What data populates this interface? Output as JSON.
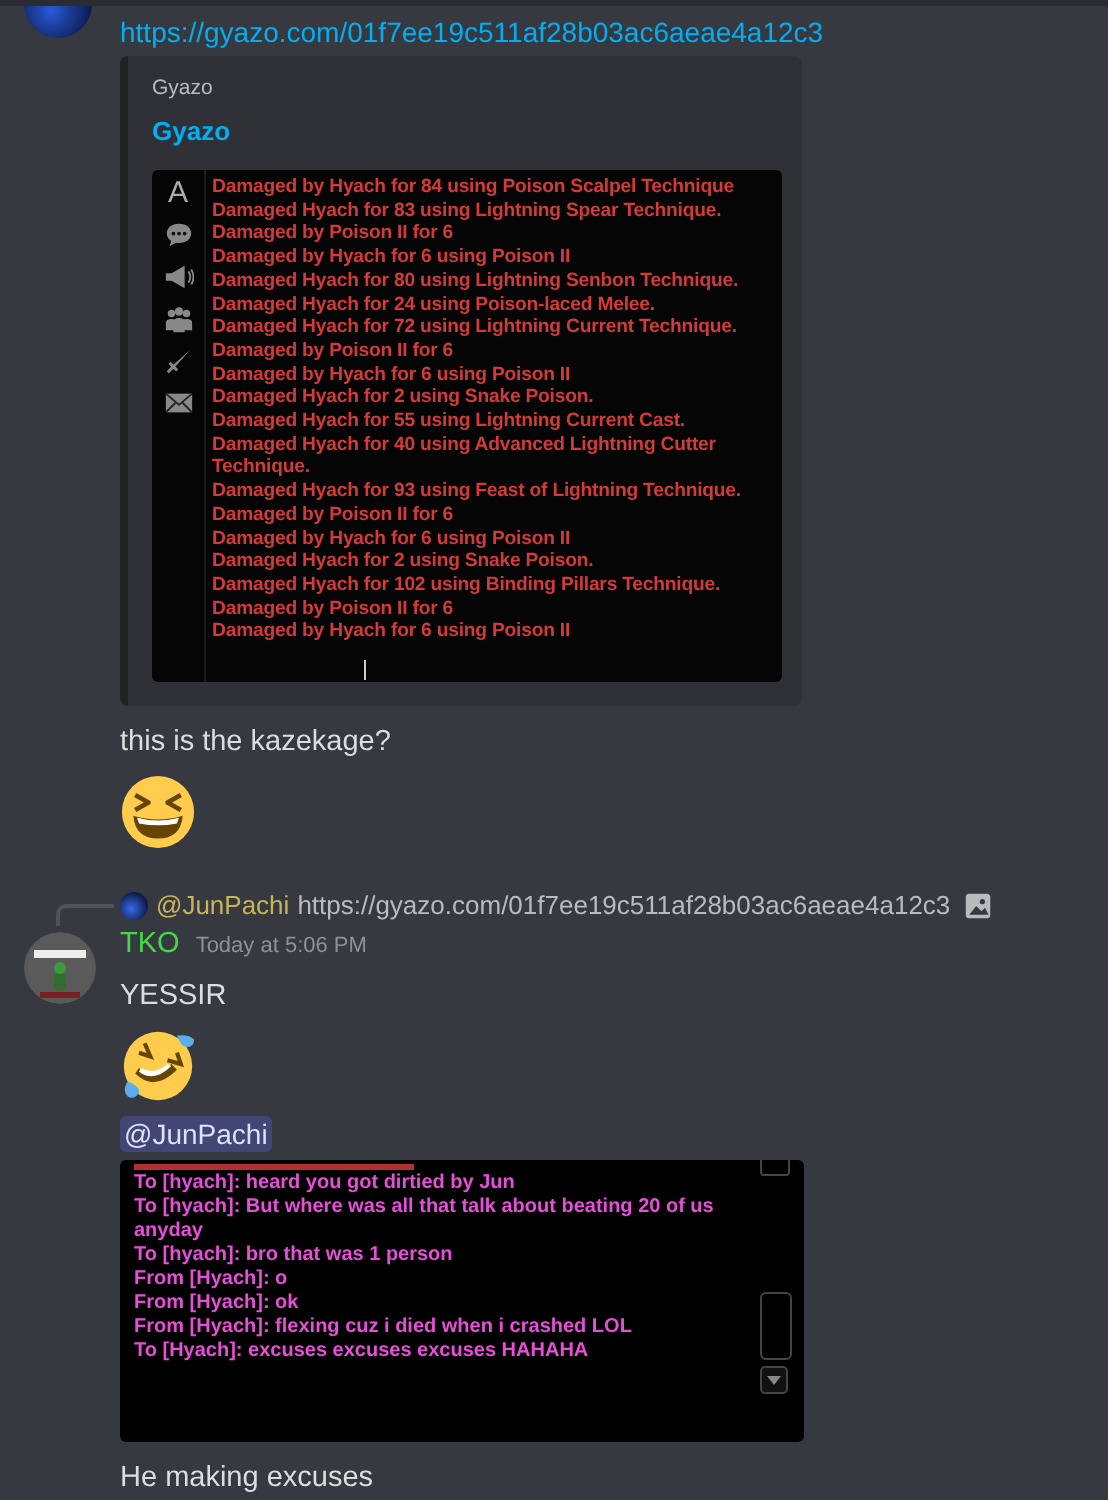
{
  "blocks": [
    {
      "kind": "link",
      "url": "https://gyazo.com/01f7ee19c511af28b03ac6aeae4a12c3"
    },
    {
      "kind": "embed",
      "provider": "Gyazo",
      "title": "Gyazo",
      "sidebar_letter": "A",
      "log": [
        "Damaged by Hyach for 84 using Poison Scalpel Technique",
        "Damaged Hyach for 83 using Lightning Spear Technique.",
        "Damaged by Poison II for 6",
        "Damaged by Hyach for 6 using Poison II",
        "Damaged Hyach for 80 using Lightning Senbon Technique.",
        "Damaged Hyach for 24 using Poison-laced Melee.",
        "Damaged Hyach for 72 using Lightning Current Technique.",
        "Damaged by Poison II for 6",
        "Damaged by Hyach for 6 using Poison II",
        "Damaged Hyach for 2 using Snake Poison.",
        "Damaged Hyach for 55 using Lightning Current Cast.",
        "Damaged Hyach for 40 using Advanced Lightning Cutter Technique.",
        "Damaged Hyach for 93 using Feast of Lightning Technique.",
        "Damaged by Poison II for 6",
        "Damaged by Hyach for 6 using Poison II",
        "Damaged Hyach for 2 using Snake Poison.",
        "Damaged Hyach for 102 using Binding Pillars Technique.",
        "Damaged by Poison II for 6",
        "Damaged by Hyach for 6 using Poison II"
      ]
    },
    {
      "kind": "text",
      "text": "this is the kazekage?"
    },
    {
      "kind": "emoji_laughing"
    },
    {
      "kind": "reply",
      "mention": "@JunPachi",
      "text": "https://gyazo.com/01f7ee19c511af28b03ac6aeae4a12c3"
    },
    {
      "kind": "author",
      "name": "TKO",
      "time": "Today at 5:06 PM"
    },
    {
      "kind": "text",
      "text": "YESSIR"
    },
    {
      "kind": "emoji_rofl"
    },
    {
      "kind": "mention",
      "text": "@JunPachi"
    },
    {
      "kind": "chatlog",
      "lines": [
        "To [hyach]: heard you got dirtied by Jun",
        "To [hyach]: But where was all that talk about beating 20 of us anyday",
        "To [hyach]: bro that was 1 person",
        "From [Hyach]: o",
        "From [Hyach]: ok",
        "From [Hyach]: flexing cuz i died when i crashed LOL",
        "To [Hyach]: excuses excuses excuses HAHAHA"
      ]
    },
    {
      "kind": "text",
      "text": "He making excuses"
    }
  ]
}
